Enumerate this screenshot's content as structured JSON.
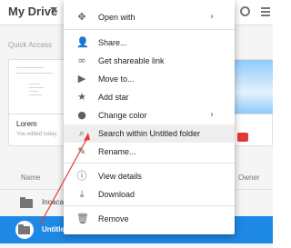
{
  "header": {
    "title": "My Drive"
  },
  "quick_access": {
    "label": "Quick Access",
    "card_left": {
      "name": "Lorem",
      "subtitle": "You edited today"
    }
  },
  "list": {
    "col_name": "Name",
    "col_owner": "Owner",
    "rows": [
      {
        "name": "Inoacademy",
        "selected": false
      },
      {
        "name": "Untitled folder",
        "selected": true
      }
    ]
  },
  "menu": {
    "items": [
      {
        "label": "Open with",
        "icon": "open-with-icon",
        "has_submenu": true
      },
      {
        "label": "Share...",
        "icon": "share-person-icon"
      },
      {
        "label": "Get shareable link",
        "icon": "link-icon"
      },
      {
        "label": "Move to...",
        "icon": "move-folder-icon"
      },
      {
        "label": "Add star",
        "icon": "star-icon"
      },
      {
        "label": "Change color",
        "icon": "palette-icon",
        "has_submenu": true
      },
      {
        "label": "Search within Untitled folder",
        "icon": "search-icon",
        "highlighted": true
      },
      {
        "label": "Rename...",
        "icon": "rename-icon"
      },
      {
        "label": "View details",
        "icon": "info-icon"
      },
      {
        "label": "Download",
        "icon": "download-icon"
      },
      {
        "label": "Remove",
        "icon": "trash-icon"
      }
    ]
  },
  "colors": {
    "selected_row": "#1e88e5",
    "annotation_arrow": "#e53935",
    "menu_highlight": "#eeeeee"
  }
}
